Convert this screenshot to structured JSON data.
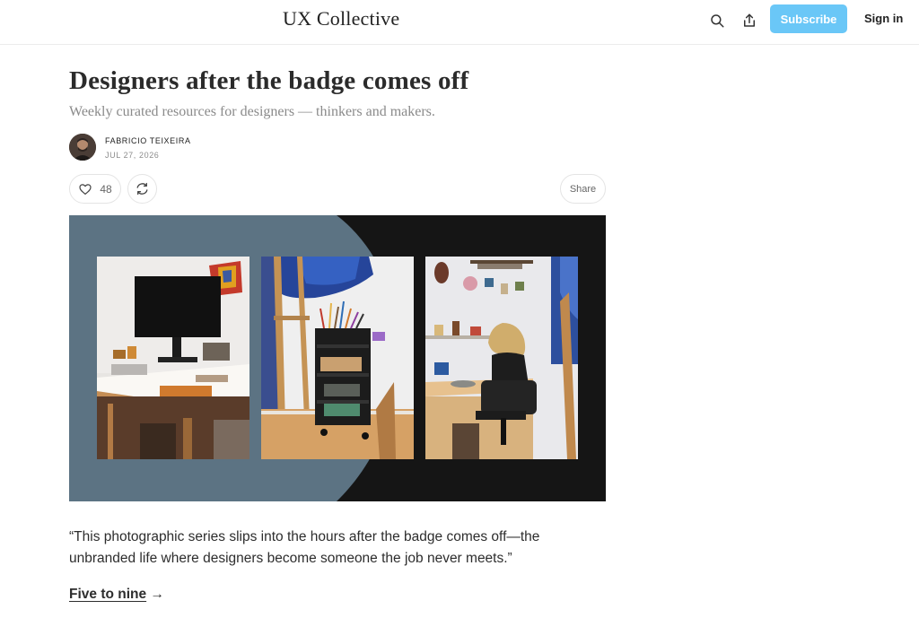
{
  "header": {
    "site_title": "UX Collective",
    "search_icon": "search-icon",
    "share_icon": "share-icon",
    "subscribe_label": "Subscribe",
    "signin_label": "Sign in",
    "accent_color": "#6ac7f7"
  },
  "article": {
    "title": "Designers after the badge comes off",
    "subtitle": "Weekly curated resources for designers — thinkers and makers.",
    "author": "FABRICIO TEIXEIRA",
    "date": "JUL 27, 2026",
    "like_count": "48",
    "share_label": "Share",
    "quote": "“This photographic series slips into the hours after the badge comes off—the unbranded life where designers become someone the job never meets.”",
    "link_text": "Five to nine",
    "link_arrow": "→"
  }
}
